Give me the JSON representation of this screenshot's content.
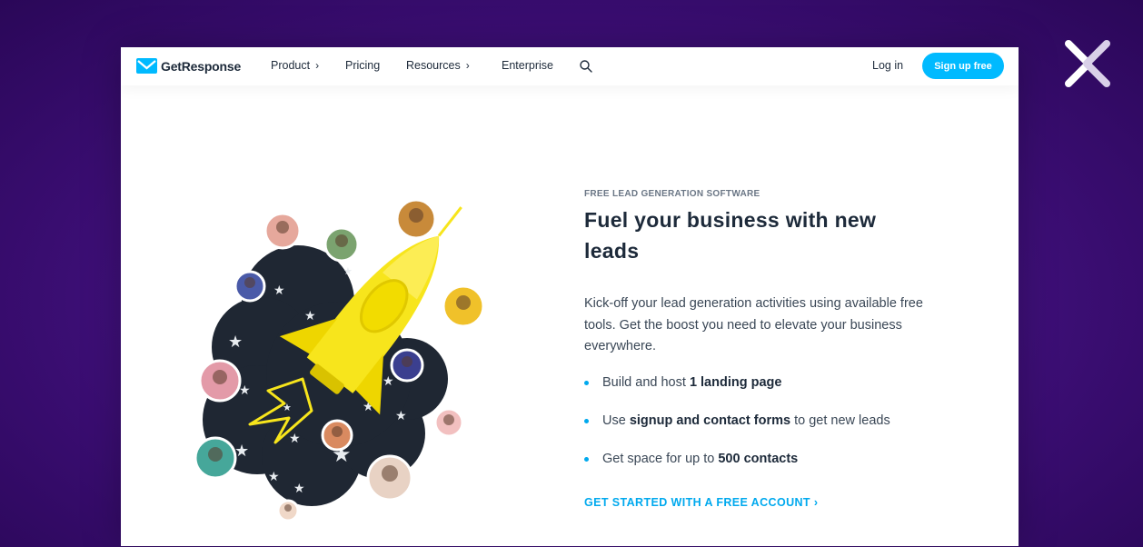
{
  "nav": {
    "brand": "GetResponse",
    "items": [
      {
        "label": "Product",
        "chevron": "›"
      },
      {
        "label": "Pricing",
        "chevron": ""
      },
      {
        "label": "Resources",
        "chevron": "›"
      },
      {
        "label": "Enterprise",
        "chevron": ""
      }
    ],
    "login": "Log in",
    "signup": "Sign up free"
  },
  "hero": {
    "eyebrow": "FREE LEAD GENERATION SOFTWARE",
    "headline": "Fuel your business with new leads",
    "description": "Kick-off your lead generation activities using available free tools. Get the boost you need to elevate your business everywhere.",
    "bullets": [
      {
        "pre": "Build and host ",
        "bold": "1 landing page",
        "post": ""
      },
      {
        "pre": "Use ",
        "bold": "signup and contact forms",
        "post": " to get new leads"
      },
      {
        "pre": "Get space for up to ",
        "bold": "500 contacts",
        "post": ""
      }
    ],
    "cta": "GET STARTED WITH A FREE ACCOUNT ›"
  },
  "colors": {
    "accent": "#00baff",
    "rocket": "#f7e51c",
    "cloud": "#1f2733",
    "background": "#3e0f78"
  },
  "icons": [
    "getresponse-logo-icon",
    "search-icon",
    "brand-x-icon",
    "rocket-illustration"
  ]
}
